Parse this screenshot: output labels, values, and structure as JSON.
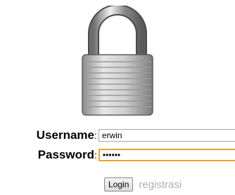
{
  "login_form": {
    "lock_image": "padlock-icon",
    "username_label": "Username",
    "username_value": "erwin",
    "password_label": "Password",
    "password_value": "••••••",
    "colon": ":",
    "login_button": "Login",
    "register_link": "registrasi"
  },
  "colors": {
    "focus_border": "#e8a531",
    "link": "#b0b0b0"
  }
}
